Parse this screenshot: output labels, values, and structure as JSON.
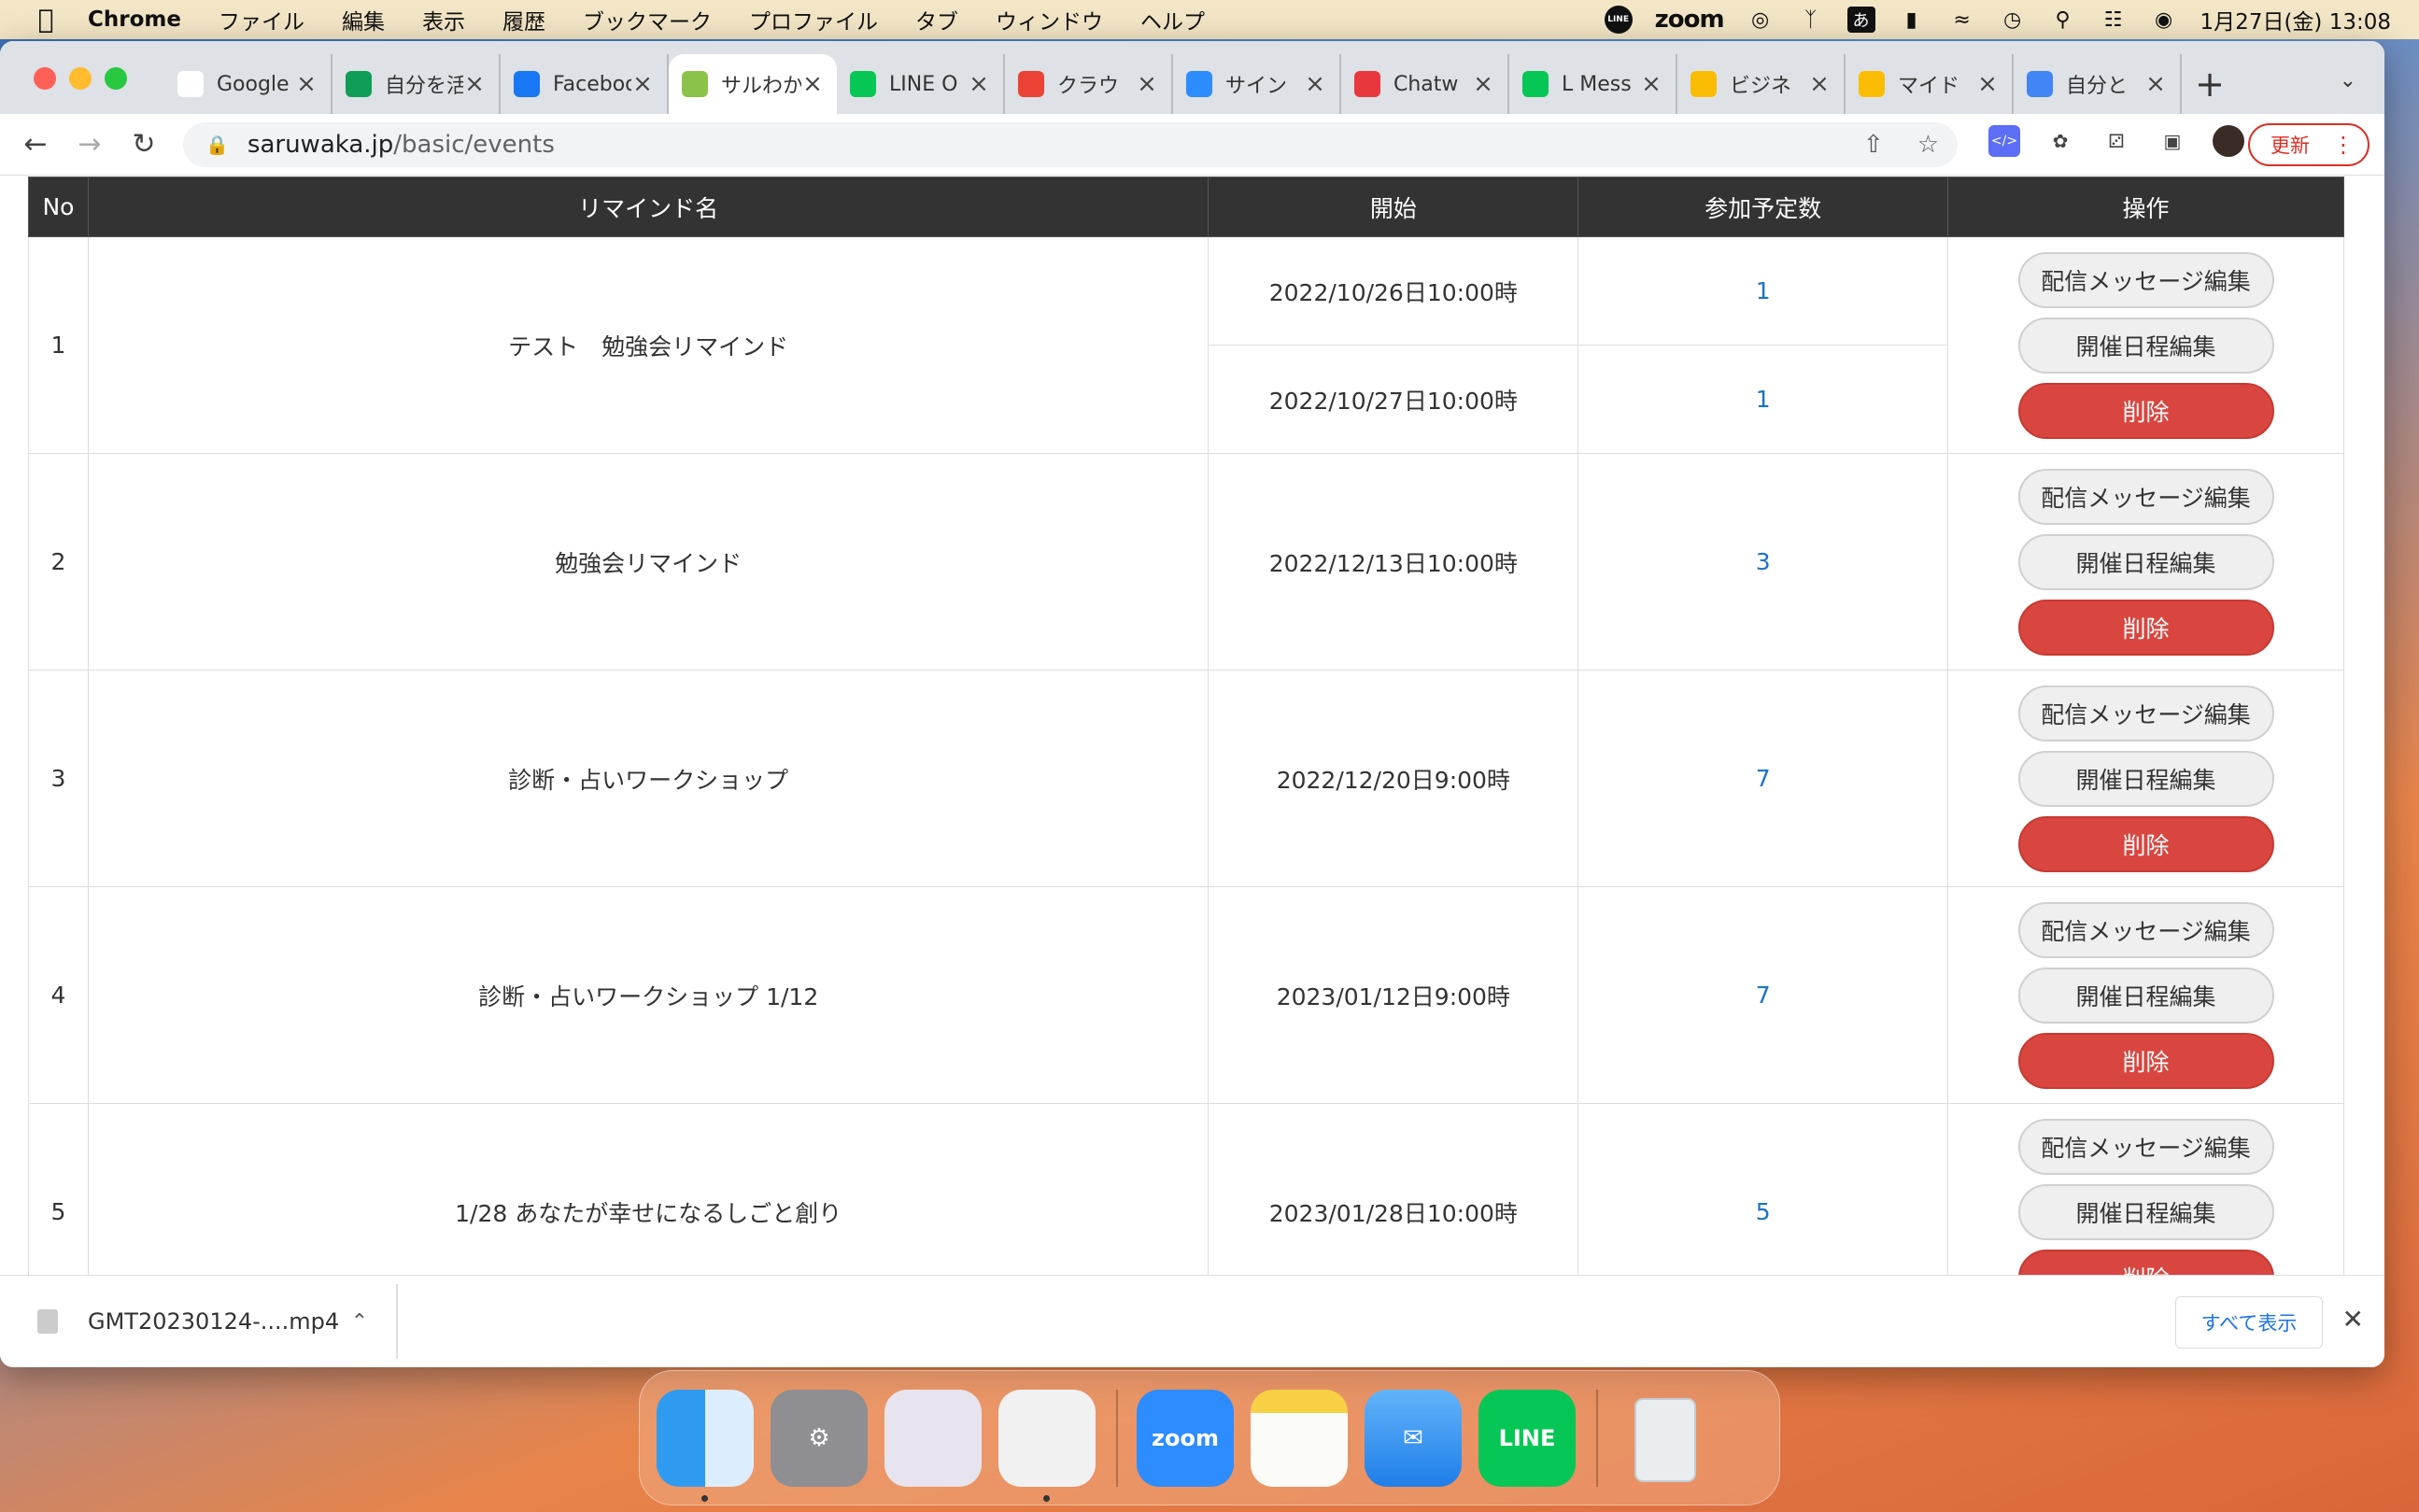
{
  "menubar": {
    "app_name": "Chrome",
    "items": [
      "ファイル",
      "編集",
      "表示",
      "履歴",
      "ブックマーク",
      "プロファイル",
      "タブ",
      "ウィンドウ",
      "ヘルプ"
    ],
    "status": {
      "line": "LINE",
      "zoom": "zoom",
      "ime": "あ",
      "datetime": "1月27日(金) 13:08"
    }
  },
  "browser": {
    "tabs": [
      {
        "title": "Google",
        "icon": "google-icon",
        "color": "#ffffff"
      },
      {
        "title": "自分を活",
        "icon": "sheets-icon",
        "color": "#0f9d58"
      },
      {
        "title": "Facebook",
        "icon": "facebook-icon",
        "color": "#1877f2"
      },
      {
        "title": "サルわか",
        "icon": "saruwaka-icon",
        "color": "#8bc34a"
      },
      {
        "title": "LINE O",
        "icon": "line-icon",
        "color": "#06c755"
      },
      {
        "title": "クラウ",
        "icon": "gmail-icon",
        "color": "#ea4335"
      },
      {
        "title": "サイン",
        "icon": "zoom-icon",
        "color": "#2d8cff"
      },
      {
        "title": "Chatw",
        "icon": "chatwork-icon",
        "color": "#e8383d"
      },
      {
        "title": "L Mess",
        "icon": "lmessage-icon",
        "color": "#06c755"
      },
      {
        "title": "ビジネ",
        "icon": "drive-icon",
        "color": "#fbbc04"
      },
      {
        "title": "マイド",
        "icon": "drive-icon",
        "color": "#fbbc04"
      },
      {
        "title": "自分と",
        "icon": "docs-icon",
        "color": "#4285f4"
      }
    ],
    "url_host": "saruwaka.jp",
    "url_path": "/basic/events",
    "update_label": "更新"
  },
  "table": {
    "headers": {
      "no": "No",
      "name": "リマインド名",
      "start": "開始",
      "count": "参加予定数",
      "ops": "操作"
    },
    "buttons": {
      "edit_message": "配信メッセージ編集",
      "edit_schedule": "開催日程編集",
      "delete": "削除"
    },
    "rows": [
      {
        "no": "1",
        "name": "テスト　勉強会リマインド",
        "start1": "2022/10/26日10:00時",
        "count1": "1",
        "start2": "2022/10/27日10:00時",
        "count2": "1"
      },
      {
        "no": "2",
        "name": "勉強会リマインド",
        "start": "2022/12/13日10:00時",
        "count": "3"
      },
      {
        "no": "3",
        "name": "診断・占いワークショップ",
        "start": "2022/12/20日9:00時",
        "count": "7"
      },
      {
        "no": "4",
        "name": "診断・占いワークショップ 1/12",
        "start": "2023/01/12日9:00時",
        "count": "7"
      },
      {
        "no": "5",
        "name": "1/28 あなたが幸せになるしごと創り",
        "start": "2023/01/28日10:00時",
        "count": "5"
      }
    ]
  },
  "download": {
    "filename": "GMT20230124-....mp4",
    "show_all": "すべて表示"
  },
  "dock": {
    "zoom": "zoom",
    "line": "LINE"
  },
  "colors": {
    "header_bg": "#333333",
    "delete_red": "#d9463f",
    "count_blue": "#1a73c8"
  }
}
